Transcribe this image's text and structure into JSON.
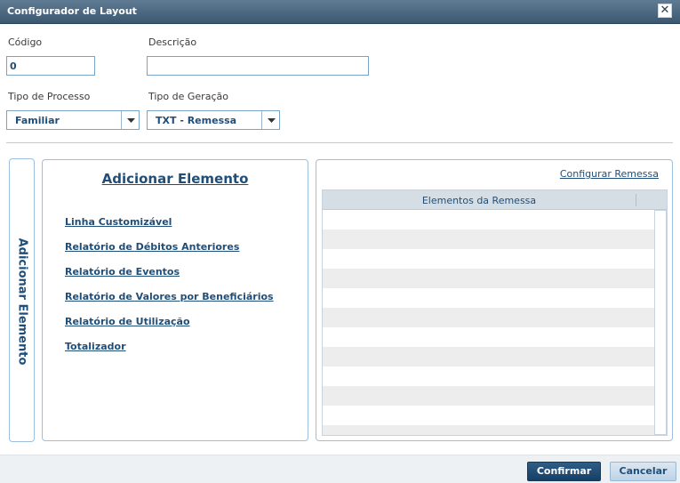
{
  "window": {
    "title": "Configurador de Layout",
    "close_glyph": "✕"
  },
  "form": {
    "codigo": {
      "label": "Código",
      "value": "0"
    },
    "descricao": {
      "label": "Descrição",
      "value": ""
    },
    "tipo_processo": {
      "label": "Tipo de Processo",
      "value": "Familiar"
    },
    "tipo_geracao": {
      "label": "Tipo de Geração",
      "value": "TXT - Remessa"
    }
  },
  "side_tab": {
    "label": "Adicionar Elemento"
  },
  "add_panel": {
    "title": "Adicionar Elemento",
    "links": [
      "Linha Customizável",
      "Relatório de Débitos Anteriores",
      "Relatório de Eventos",
      "Relatório de Valores por Beneficiários",
      "Relatório de Utilização",
      "Totalizador"
    ]
  },
  "remessa_panel": {
    "config_link": "Configurar Remessa",
    "grid_header": "Elementos da Remessa",
    "rows": [
      "",
      "",
      "",
      "",
      "",
      "",
      "",
      "",
      "",
      "",
      "",
      ""
    ]
  },
  "footer": {
    "confirm_label": "Confirmar",
    "cancel_label": "Cancelar"
  },
  "colors": {
    "titlebar": "#3b5870",
    "accent": "#1f4e79",
    "border": "#9dbfdd"
  }
}
